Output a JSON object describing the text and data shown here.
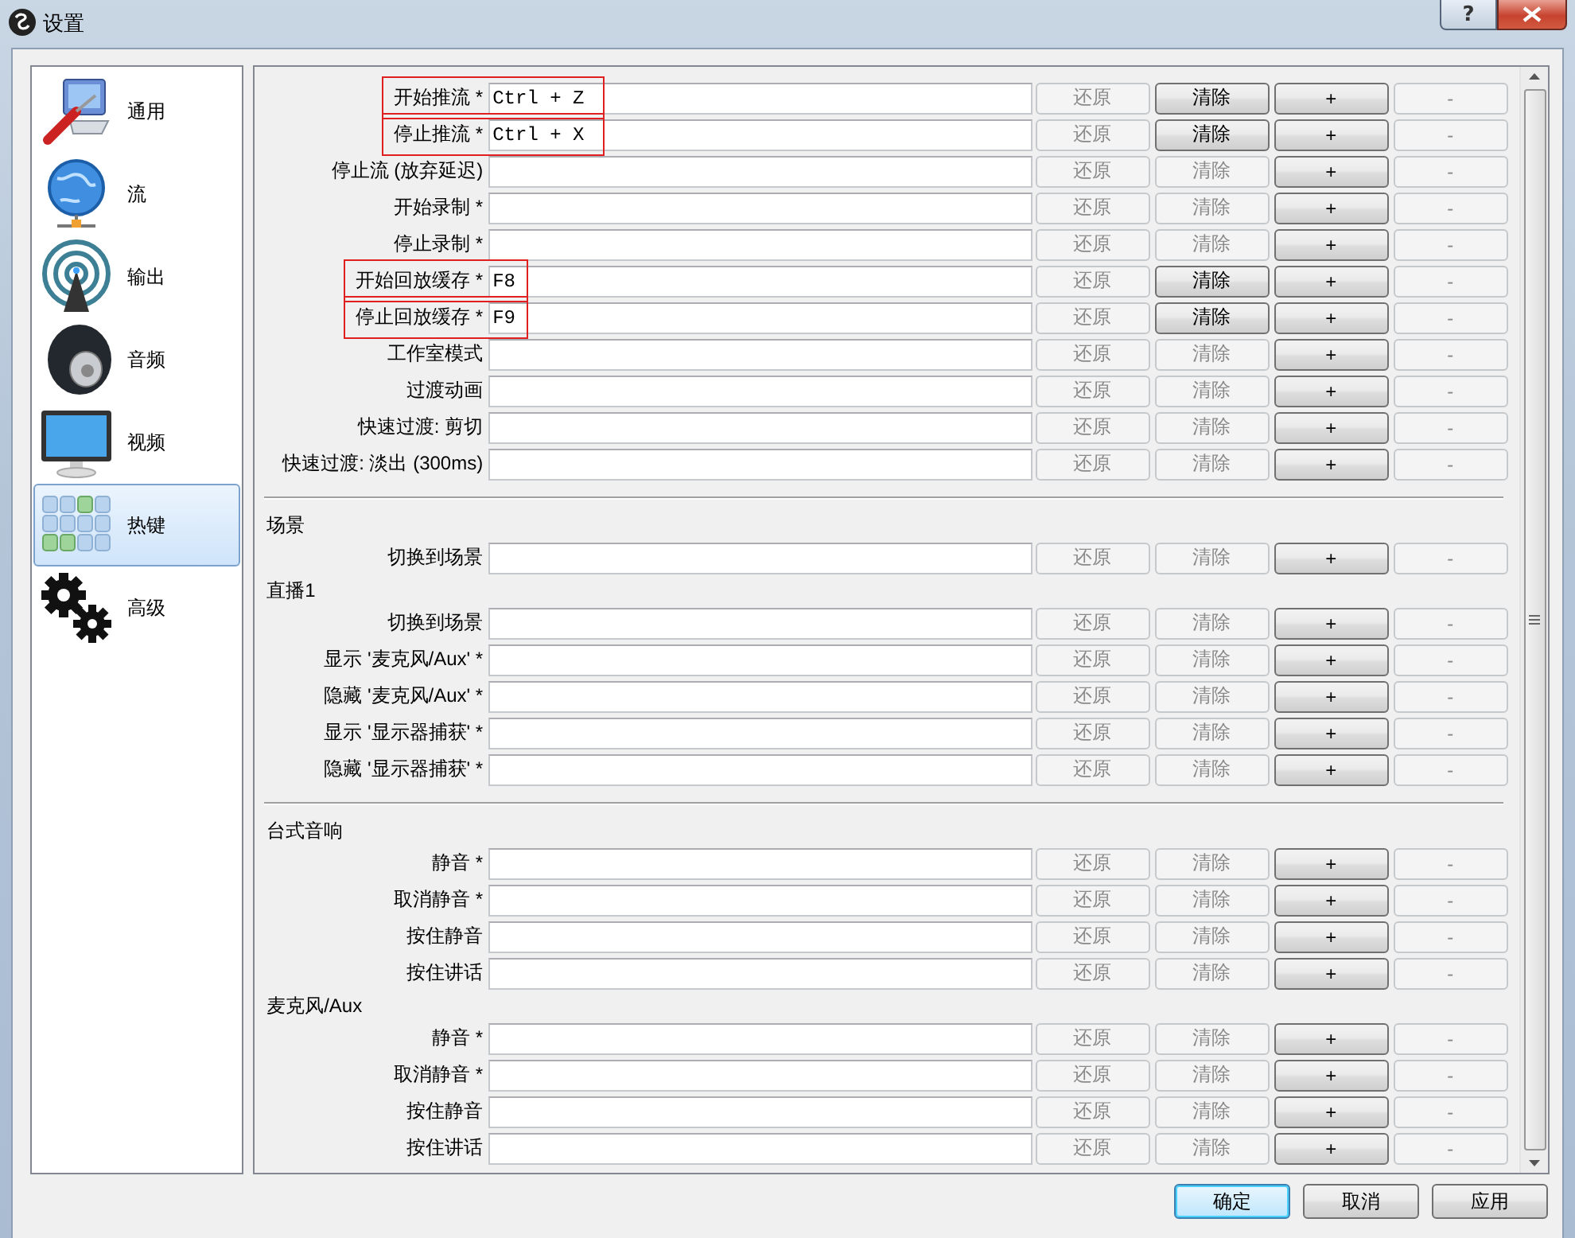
{
  "window": {
    "title": "设置",
    "help_button": "?"
  },
  "sidebar": {
    "items": [
      {
        "label": "通用",
        "kind": "general",
        "selected": false
      },
      {
        "label": "流",
        "kind": "stream",
        "selected": false
      },
      {
        "label": "输出",
        "kind": "output",
        "selected": false
      },
      {
        "label": "音频",
        "kind": "audio",
        "selected": false
      },
      {
        "label": "视频",
        "kind": "video",
        "selected": false
      },
      {
        "label": "热键",
        "kind": "hotkeys",
        "selected": true
      },
      {
        "label": "高级",
        "kind": "advanced",
        "selected": false
      }
    ]
  },
  "groups": [
    {
      "sections": [
        {
          "rows": [
            {
              "label": "开始推流 *",
              "value": "Ctrl + Z",
              "highlighted": true,
              "buttons": [
                {
                  "label": "还原",
                  "disabled": true
                },
                {
                  "label": "清除",
                  "disabled": false
                },
                {
                  "label": "+",
                  "disabled": false
                },
                {
                  "label": "-",
                  "disabled": true
                }
              ]
            },
            {
              "label": "停止推流 *",
              "value": "Ctrl + X",
              "highlighted": true,
              "buttons": [
                {
                  "label": "还原",
                  "disabled": true
                },
                {
                  "label": "清除",
                  "disabled": false
                },
                {
                  "label": "+",
                  "disabled": false
                },
                {
                  "label": "-",
                  "disabled": true
                }
              ]
            },
            {
              "label": "停止流 (放弃延迟)",
              "value": "",
              "highlighted": false,
              "buttons": [
                {
                  "label": "还原",
                  "disabled": true
                },
                {
                  "label": "清除",
                  "disabled": true
                },
                {
                  "label": "+",
                  "disabled": false
                },
                {
                  "label": "-",
                  "disabled": true
                }
              ]
            },
            {
              "label": "开始录制 *",
              "value": "",
              "highlighted": false,
              "buttons": [
                {
                  "label": "还原",
                  "disabled": true
                },
                {
                  "label": "清除",
                  "disabled": true
                },
                {
                  "label": "+",
                  "disabled": false
                },
                {
                  "label": "-",
                  "disabled": true
                }
              ]
            },
            {
              "label": "停止录制 *",
              "value": "",
              "highlighted": false,
              "buttons": [
                {
                  "label": "还原",
                  "disabled": true
                },
                {
                  "label": "清除",
                  "disabled": true
                },
                {
                  "label": "+",
                  "disabled": false
                },
                {
                  "label": "-",
                  "disabled": true
                }
              ]
            },
            {
              "label": "开始回放缓存 *",
              "value": "F8",
              "highlighted": true,
              "buttons": [
                {
                  "label": "还原",
                  "disabled": true
                },
                {
                  "label": "清除",
                  "disabled": false
                },
                {
                  "label": "+",
                  "disabled": false
                },
                {
                  "label": "-",
                  "disabled": true
                }
              ]
            },
            {
              "label": "停止回放缓存 *",
              "value": "F9",
              "highlighted": true,
              "buttons": [
                {
                  "label": "还原",
                  "disabled": true
                },
                {
                  "label": "清除",
                  "disabled": false
                },
                {
                  "label": "+",
                  "disabled": false
                },
                {
                  "label": "-",
                  "disabled": true
                }
              ]
            },
            {
              "label": "工作室模式",
              "value": "",
              "highlighted": false,
              "buttons": [
                {
                  "label": "还原",
                  "disabled": true
                },
                {
                  "label": "清除",
                  "disabled": true
                },
                {
                  "label": "+",
                  "disabled": false
                },
                {
                  "label": "-",
                  "disabled": true
                }
              ]
            },
            {
              "label": "过渡动画",
              "value": "",
              "highlighted": false,
              "buttons": [
                {
                  "label": "还原",
                  "disabled": true
                },
                {
                  "label": "清除",
                  "disabled": true
                },
                {
                  "label": "+",
                  "disabled": false
                },
                {
                  "label": "-",
                  "disabled": true
                }
              ]
            },
            {
              "label": "快速过渡: 剪切",
              "value": "",
              "highlighted": false,
              "buttons": [
                {
                  "label": "还原",
                  "disabled": true
                },
                {
                  "label": "清除",
                  "disabled": true
                },
                {
                  "label": "+",
                  "disabled": false
                },
                {
                  "label": "-",
                  "disabled": true
                }
              ]
            },
            {
              "label": "快速过渡: 淡出 (300ms)",
              "value": "",
              "highlighted": false,
              "buttons": [
                {
                  "label": "还原",
                  "disabled": true
                },
                {
                  "label": "清除",
                  "disabled": true
                },
                {
                  "label": "+",
                  "disabled": false
                },
                {
                  "label": "-",
                  "disabled": true
                }
              ]
            }
          ]
        }
      ]
    },
    {
      "sections": [
        {
          "heading": "场景",
          "rows": [
            {
              "label": "切换到场景",
              "value": "",
              "highlighted": false,
              "buttons": [
                {
                  "label": "还原",
                  "disabled": true
                },
                {
                  "label": "清除",
                  "disabled": true
                },
                {
                  "label": "+",
                  "disabled": false
                },
                {
                  "label": "-",
                  "disabled": true
                }
              ]
            }
          ]
        },
        {
          "heading": "直播1",
          "rows": [
            {
              "label": "切换到场景",
              "value": "",
              "highlighted": false,
              "buttons": [
                {
                  "label": "还原",
                  "disabled": true
                },
                {
                  "label": "清除",
                  "disabled": true
                },
                {
                  "label": "+",
                  "disabled": false
                },
                {
                  "label": "-",
                  "disabled": true
                }
              ]
            },
            {
              "label": "显示 '麦克风/Aux' *",
              "value": "",
              "highlighted": false,
              "buttons": [
                {
                  "label": "还原",
                  "disabled": true
                },
                {
                  "label": "清除",
                  "disabled": true
                },
                {
                  "label": "+",
                  "disabled": false
                },
                {
                  "label": "-",
                  "disabled": true
                }
              ]
            },
            {
              "label": "隐藏 '麦克风/Aux' *",
              "value": "",
              "highlighted": false,
              "buttons": [
                {
                  "label": "还原",
                  "disabled": true
                },
                {
                  "label": "清除",
                  "disabled": true
                },
                {
                  "label": "+",
                  "disabled": false
                },
                {
                  "label": "-",
                  "disabled": true
                }
              ]
            },
            {
              "label": "显示 '显示器捕获' *",
              "value": "",
              "highlighted": false,
              "buttons": [
                {
                  "label": "还原",
                  "disabled": true
                },
                {
                  "label": "清除",
                  "disabled": true
                },
                {
                  "label": "+",
                  "disabled": false
                },
                {
                  "label": "-",
                  "disabled": true
                }
              ]
            },
            {
              "label": "隐藏 '显示器捕获' *",
              "value": "",
              "highlighted": false,
              "buttons": [
                {
                  "label": "还原",
                  "disabled": true
                },
                {
                  "label": "清除",
                  "disabled": true
                },
                {
                  "label": "+",
                  "disabled": false
                },
                {
                  "label": "-",
                  "disabled": true
                }
              ]
            }
          ]
        }
      ]
    },
    {
      "sections": [
        {
          "heading": "台式音响",
          "rows": [
            {
              "label": "静音 *",
              "value": "",
              "highlighted": false,
              "buttons": [
                {
                  "label": "还原",
                  "disabled": true
                },
                {
                  "label": "清除",
                  "disabled": true
                },
                {
                  "label": "+",
                  "disabled": false
                },
                {
                  "label": "-",
                  "disabled": true
                }
              ]
            },
            {
              "label": "取消静音 *",
              "value": "",
              "highlighted": false,
              "buttons": [
                {
                  "label": "还原",
                  "disabled": true
                },
                {
                  "label": "清除",
                  "disabled": true
                },
                {
                  "label": "+",
                  "disabled": false
                },
                {
                  "label": "-",
                  "disabled": true
                }
              ]
            },
            {
              "label": "按住静音",
              "value": "",
              "highlighted": false,
              "buttons": [
                {
                  "label": "还原",
                  "disabled": true
                },
                {
                  "label": "清除",
                  "disabled": true
                },
                {
                  "label": "+",
                  "disabled": false
                },
                {
                  "label": "-",
                  "disabled": true
                }
              ]
            },
            {
              "label": "按住讲话",
              "value": "",
              "highlighted": false,
              "buttons": [
                {
                  "label": "还原",
                  "disabled": true
                },
                {
                  "label": "清除",
                  "disabled": true
                },
                {
                  "label": "+",
                  "disabled": false
                },
                {
                  "label": "-",
                  "disabled": true
                }
              ]
            }
          ]
        },
        {
          "heading": "麦克风/Aux",
          "rows": [
            {
              "label": "静音 *",
              "value": "",
              "highlighted": false,
              "buttons": [
                {
                  "label": "还原",
                  "disabled": true
                },
                {
                  "label": "清除",
                  "disabled": true
                },
                {
                  "label": "+",
                  "disabled": false
                },
                {
                  "label": "-",
                  "disabled": true
                }
              ]
            },
            {
              "label": "取消静音 *",
              "value": "",
              "highlighted": false,
              "buttons": [
                {
                  "label": "还原",
                  "disabled": true
                },
                {
                  "label": "清除",
                  "disabled": true
                },
                {
                  "label": "+",
                  "disabled": false
                },
                {
                  "label": "-",
                  "disabled": true
                }
              ]
            },
            {
              "label": "按住静音",
              "value": "",
              "highlighted": false,
              "buttons": [
                {
                  "label": "还原",
                  "disabled": true
                },
                {
                  "label": "清除",
                  "disabled": true
                },
                {
                  "label": "+",
                  "disabled": false
                },
                {
                  "label": "-",
                  "disabled": true
                }
              ]
            },
            {
              "label": "按住讲话",
              "value": "",
              "highlighted": false,
              "buttons": [
                {
                  "label": "还原",
                  "disabled": true
                },
                {
                  "label": "清除",
                  "disabled": true
                },
                {
                  "label": "+",
                  "disabled": false
                },
                {
                  "label": "-",
                  "disabled": true
                }
              ]
            }
          ]
        }
      ]
    }
  ],
  "footer": {
    "buttons": [
      {
        "label": "确定",
        "default": true
      },
      {
        "label": "取消",
        "default": false
      },
      {
        "label": "应用",
        "default": false
      }
    ]
  }
}
